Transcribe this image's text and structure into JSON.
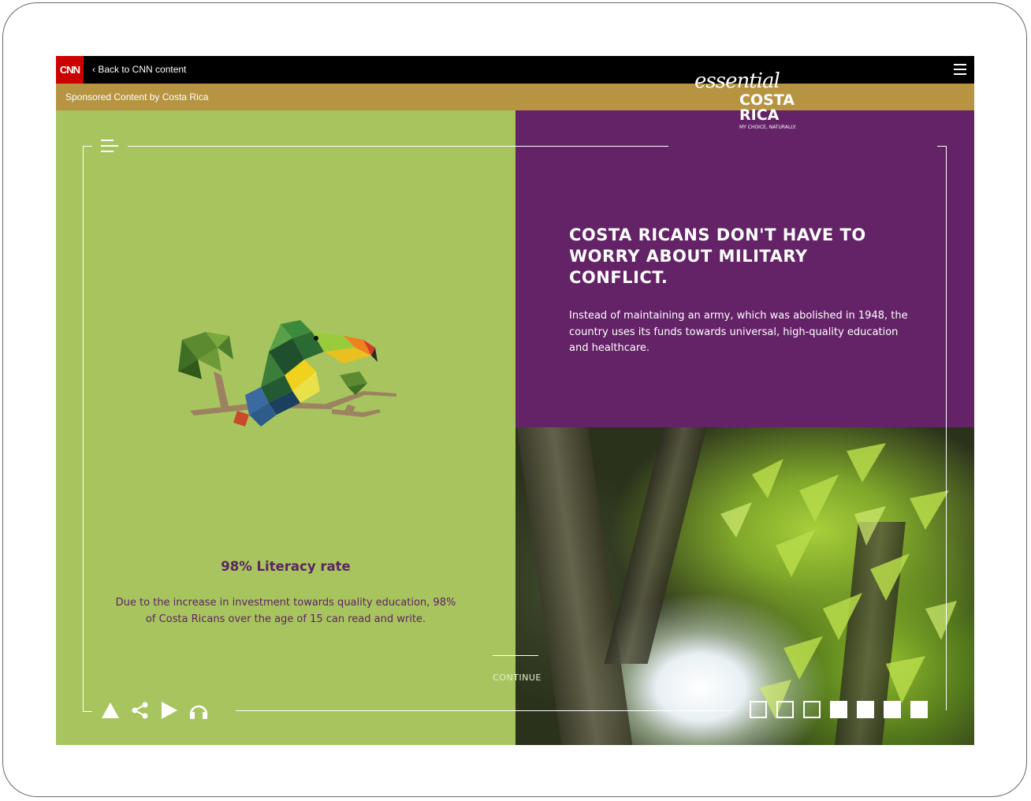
{
  "topbar": {
    "logo_text": "CNN",
    "back_label": "‹ Back to CNN content",
    "menu_icon": "hamburger-icon"
  },
  "sponsor": {
    "label": "Sponsored Content by Costa Rica"
  },
  "brand": {
    "script": "essential",
    "line1": "COSTA",
    "line2": "RICA",
    "tagline": "MY CHOICE, NATURALLY."
  },
  "article": {
    "headline": "COSTA RICANS DON'T HAVE TO WORRY ABOUT MILITARY CONFLICT.",
    "body": "Instead of maintaining an army, which was abolished in 1948, the country uses its funds towards universal, high-quality education and healthcare."
  },
  "stat": {
    "title": "98% Literacy rate",
    "body": "Due to the increase in investment towards quality education, 98% of Costa Ricans over the age of 15 can read and write."
  },
  "continue_label": "CONTINUE",
  "controls": [
    "home-icon",
    "share-icon",
    "play-icon",
    "audio-icon"
  ],
  "pagination": {
    "total": 7,
    "current": 3
  },
  "colors": {
    "green_panel": "#a8c45e",
    "purple_panel": "#642267",
    "sponsor_bar": "#b69442",
    "cnn_red": "#cc0000",
    "stat_text": "#5b2463"
  }
}
